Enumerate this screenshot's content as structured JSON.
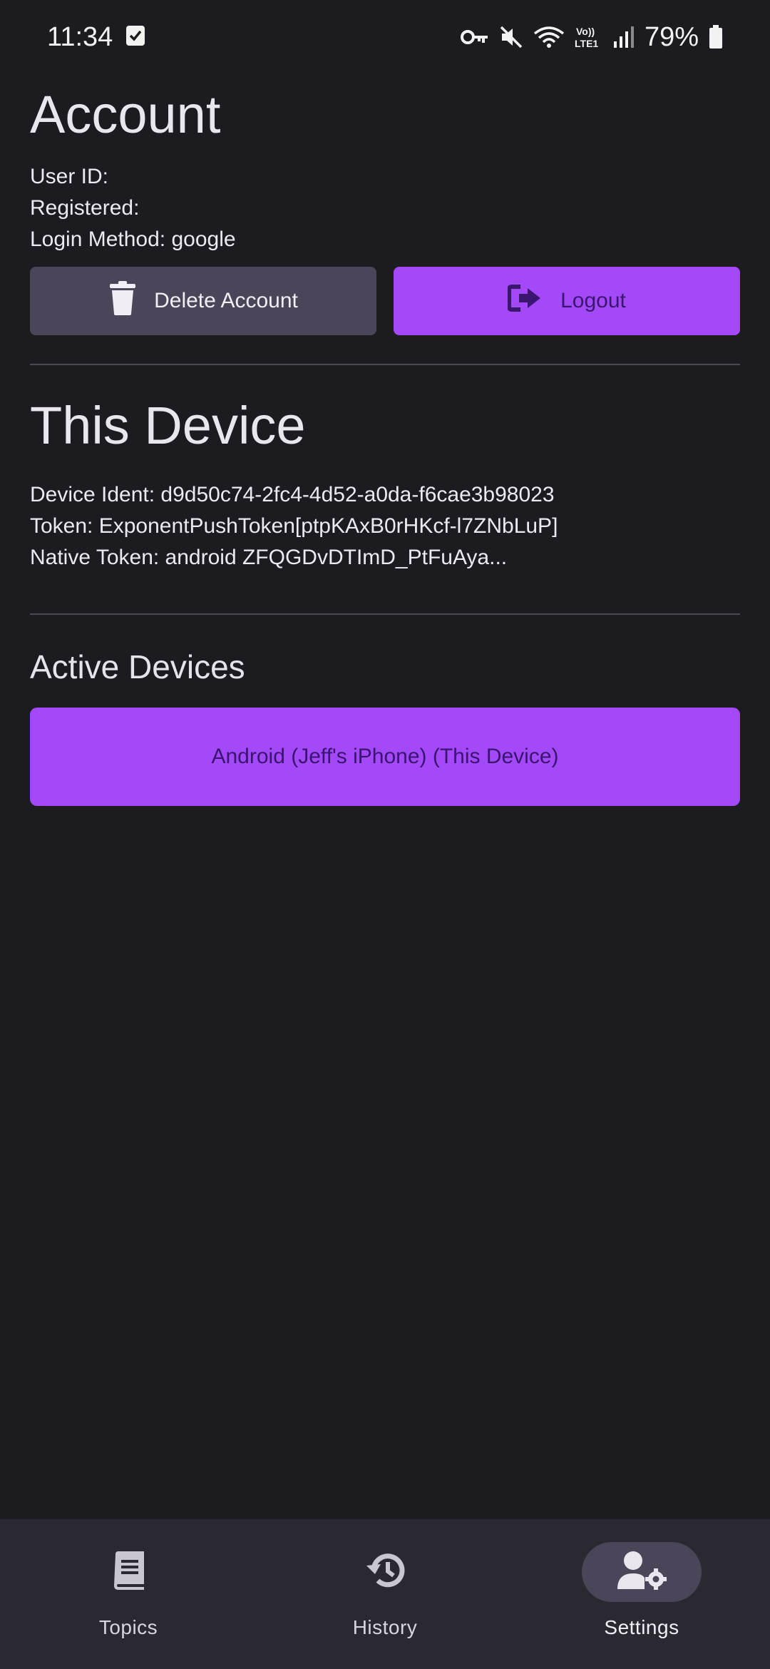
{
  "status_bar": {
    "time": "11:34",
    "battery": "79%",
    "icons": [
      "checkbox-notification-icon",
      "vpn-key-icon",
      "mute-icon",
      "wifi-icon",
      "volte-icon",
      "signal-icon",
      "battery-icon"
    ]
  },
  "account": {
    "title": "Account",
    "user_id": "User ID:",
    "registered": "Registered:",
    "login_method": "Login Method: google",
    "delete_button": "Delete Account",
    "logout_button": "Logout"
  },
  "this_device": {
    "title": "This Device",
    "device_ident": "Device Ident: d9d50c74-2fc4-4d52-a0da-f6cae3b98023",
    "token": "Token: ExponentPushToken[ptpKAxB0rHKcf-l7ZNbLuP]",
    "native_token": "Native Token: android ZFQGDvDTImD_PtFuAya..."
  },
  "active_devices": {
    "title": "Active Devices",
    "devices": [
      "Android (Jeff's iPhone) (This Device)"
    ]
  },
  "bottom_nav": {
    "items": [
      {
        "label": "Topics",
        "icon": "book-icon"
      },
      {
        "label": "History",
        "icon": "history-icon"
      },
      {
        "label": "Settings",
        "icon": "user-settings-icon",
        "active": true
      }
    ]
  },
  "colors": {
    "background": "#1c1b20",
    "accent": "#a349f8",
    "secondary_button": "#4a4558",
    "nav_background": "#2a2830"
  }
}
